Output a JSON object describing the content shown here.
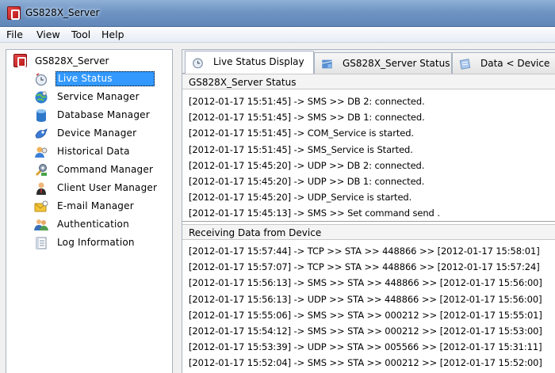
{
  "window": {
    "title": "GS828X_Server"
  },
  "menu": [
    "File",
    "View",
    "Tool",
    "Help"
  ],
  "tree": {
    "root": "GS828X_Server",
    "items": [
      {
        "label": "Live Status",
        "icon": "clock-icon"
      },
      {
        "label": "Service Manager",
        "icon": "globe-icon"
      },
      {
        "label": "Database Manager",
        "icon": "database-icon"
      },
      {
        "label": "Device Manager",
        "icon": "device-icon"
      },
      {
        "label": "Historical Data",
        "icon": "history-icon"
      },
      {
        "label": "Command Manager",
        "icon": "command-icon"
      },
      {
        "label": "Client User Manager",
        "icon": "user-icon"
      },
      {
        "label": "E-mail Manager",
        "icon": "email-icon"
      },
      {
        "label": "Authentication",
        "icon": "users-icon"
      },
      {
        "label": "Log Information",
        "icon": "log-icon"
      }
    ],
    "selected": "Live Status"
  },
  "tabs": [
    {
      "label": "Live Status Display",
      "icon": "clock-icon"
    },
    {
      "label": "GS828X_Server Status",
      "icon": "server-icon"
    },
    {
      "label": "Data < Device",
      "icon": "data-icon"
    }
  ],
  "status_section": {
    "title": "GS828X_Server Status",
    "lines": [
      "[2012-01-17 15:51:45] -> SMS >> DB 2: connected.",
      "[2012-01-17 15:51:45] -> SMS >> DB 1: connected.",
      "[2012-01-17 15:51:45] -> COM_Service is started.",
      "[2012-01-17 15:51:45] -> SMS_Service is Started.",
      "[2012-01-17 15:45:20] -> UDP >> DB 2: connected.",
      "[2012-01-17 15:45:20] -> UDP >> DB 1: connected.",
      "[2012-01-17 15:45:20] -> UDP_Service is started.",
      "[2012-01-17 15:45:13] -> SMS >> Set command send ."
    ]
  },
  "receive_section": {
    "title": "Receiving Data from Device",
    "lines": [
      "[2012-01-17 15:57:44] -> TCP >> STA >> 448866 >> [2012-01-17 15:58:01]",
      "[2012-01-17 15:57:07] -> TCP >> STA >> 448866 >> [2012-01-17 15:57:24]",
      "[2012-01-17 15:56:13] -> SMS >> STA >> 448866 >> [2012-01-17 15:56:00]",
      "[2012-01-17 15:56:13] -> UDP >> STA >> 448866 >> [2012-01-17 15:56:00]",
      "[2012-01-17 15:55:06] -> SMS >> STA >> 000212 >> [2012-01-17 15:55:01]",
      "[2012-01-17 15:54:12] -> SMS >> STA >> 000212 >> [2012-01-17 15:53:00]",
      "[2012-01-17 15:53:39] -> UDP >> STA >> 005566 >> [2012-01-17 15:31:11]",
      "[2012-01-17 15:52:04] -> SMS >> STA >> 000212 >> [2012-01-17 15:52:00]"
    ]
  }
}
